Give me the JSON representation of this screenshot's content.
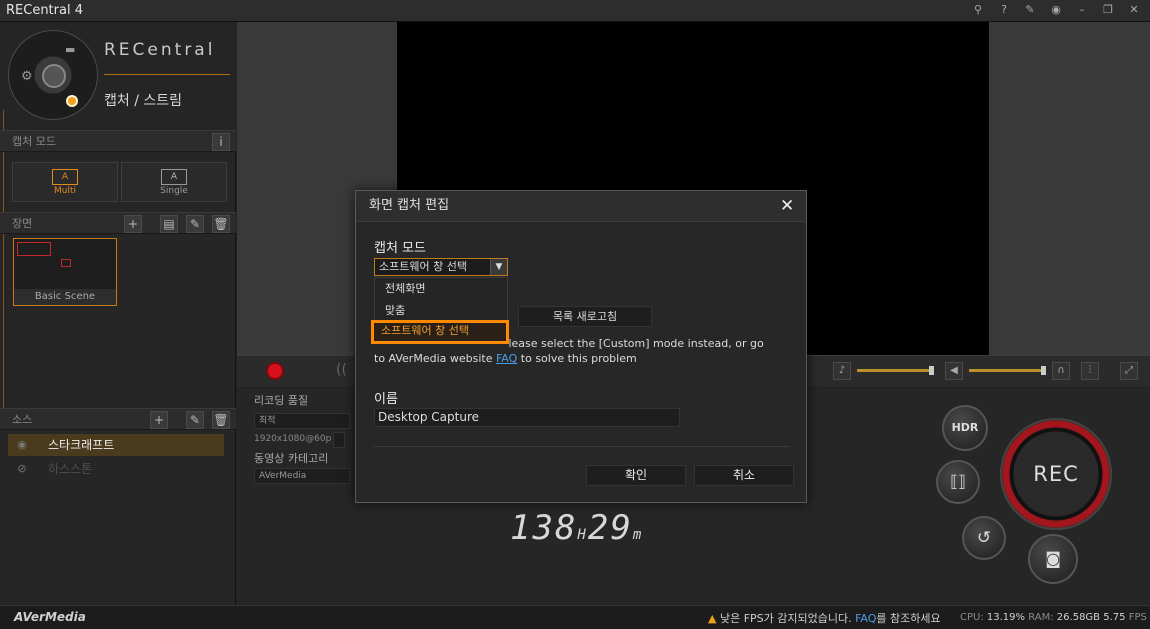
{
  "window": {
    "title": "RECentral 4"
  },
  "titlebar_icons": [
    "pin-icon",
    "help-icon",
    "pushpin-icon",
    "eye-icon",
    "minimize-icon",
    "restore-icon",
    "close-icon"
  ],
  "sidebar": {
    "brand": "RECentral",
    "subtitle": "캡처 / 스트림",
    "capture_mode_label": "캡처 모드",
    "info_label": "i",
    "modes": [
      {
        "box": "A",
        "label": "Multi",
        "active": true
      },
      {
        "box": "A",
        "label": "Single",
        "active": false
      }
    ],
    "scene_label": "장면",
    "scene_name": "Basic Scene",
    "source_label": "소스",
    "sources": [
      {
        "name": "스타크래프트",
        "selected": true
      },
      {
        "name": "하스스톤",
        "selected": false
      }
    ]
  },
  "lower": {
    "quality_label": "리코딩 품질",
    "quality_value": "최적",
    "resolution": "1920x1080@60p",
    "category_label": "동영상 카테고리",
    "category_value": "AVerMedia",
    "time_hours": "138",
    "time_h": "H",
    "time_minutes": "29",
    "time_m": "m",
    "hdr_label": "HDR",
    "rec_label": "REC"
  },
  "dialog": {
    "title": "화면 캡처 편집",
    "capture_mode_label": "캡처 모드",
    "selected_option": "소프트웨어 창 선택",
    "options": [
      "전체화면",
      "맞춤",
      "소프트웨어 창 선택"
    ],
    "refresh_label": "목록 새로고침",
    "help_line1": "If the preview is black, please select the [Custom] mode instead, or go",
    "help_line2_pre": "to AVerMedia website ",
    "help_link": "FAQ",
    "help_line2_post": " to solve this problem",
    "name_label": "이름",
    "name_value": "Desktop Capture",
    "ok_label": "확인",
    "cancel_label": "취소"
  },
  "statusbar": {
    "brand": "AVerMedia",
    "warning_pre": "낮은 FPS가 감지되었습니다. ",
    "warning_link": "FAQ",
    "warning_post": "를 참조하세요",
    "cpu_label": "CPU:",
    "cpu_value": "13.19%",
    "ram_label": "RAM:",
    "ram_value": "26.58GB",
    "fps_value": "5.75",
    "fps_label": "FPS"
  },
  "colors": {
    "accent": "#e08b1e",
    "rec_red": "#d6121f",
    "link": "#4f9be6"
  }
}
